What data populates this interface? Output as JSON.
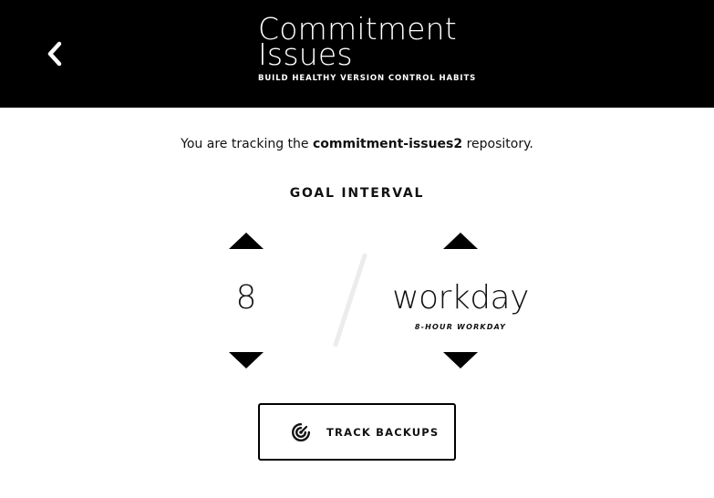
{
  "header": {
    "title_line1": "Commitment",
    "title_line2": "Issues",
    "tagline": "BUILD HEALTHY VERSION CONTROL HABITS",
    "back_icon": "chevron-left-icon"
  },
  "tracking": {
    "prefix": "You are tracking the ",
    "repo_name": "commitment-issues2",
    "suffix": " repository."
  },
  "goal": {
    "heading": "GOAL INTERVAL",
    "count": "8",
    "unit": "workday",
    "unit_description": "8-HOUR WORKDAY"
  },
  "action": {
    "button_label": "TRACK BACKUPS",
    "icon": "target-icon"
  },
  "colors": {
    "header_bg": "#000000",
    "header_text": "#ffffff",
    "body_bg": "#ffffff",
    "text": "#111111",
    "slash": "#ececec"
  }
}
